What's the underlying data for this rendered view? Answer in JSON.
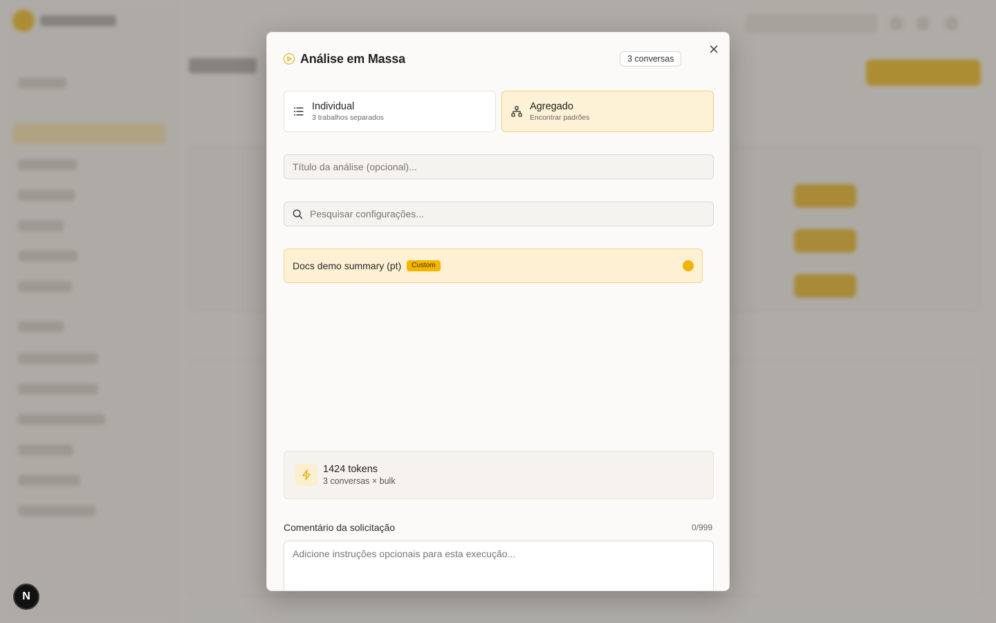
{
  "modal": {
    "title": "Análise em Massa",
    "count_badge": "3 conversas",
    "modes": [
      {
        "label": "Individual",
        "sub": "3 trabalhos separados",
        "icon": "list-icon",
        "active": false
      },
      {
        "label": "Agregado",
        "sub": "Encontrar padrões",
        "icon": "network-icon",
        "active": true
      }
    ],
    "title_input": {
      "placeholder": "Título da análise (opcional)...",
      "value": ""
    },
    "search_input": {
      "placeholder": "Pesquisar configurações...",
      "value": ""
    },
    "configs": [
      {
        "name": "Docs demo summary (pt)",
        "tag": "Custom",
        "selected": true
      }
    ],
    "tokens": {
      "count": "1424 tokens",
      "detail": "3 conversas × bulk"
    },
    "comment": {
      "label": "Comentário da solicitação",
      "counter": "0/999",
      "placeholder": "Adicione instruções opcionais para esta execução..."
    }
  },
  "colors": {
    "accent": "#f0b400",
    "active_card_bg": "#fdf1d6",
    "overlay": "rgba(110,106,100,0.52)"
  },
  "badge": {
    "label": "N"
  }
}
